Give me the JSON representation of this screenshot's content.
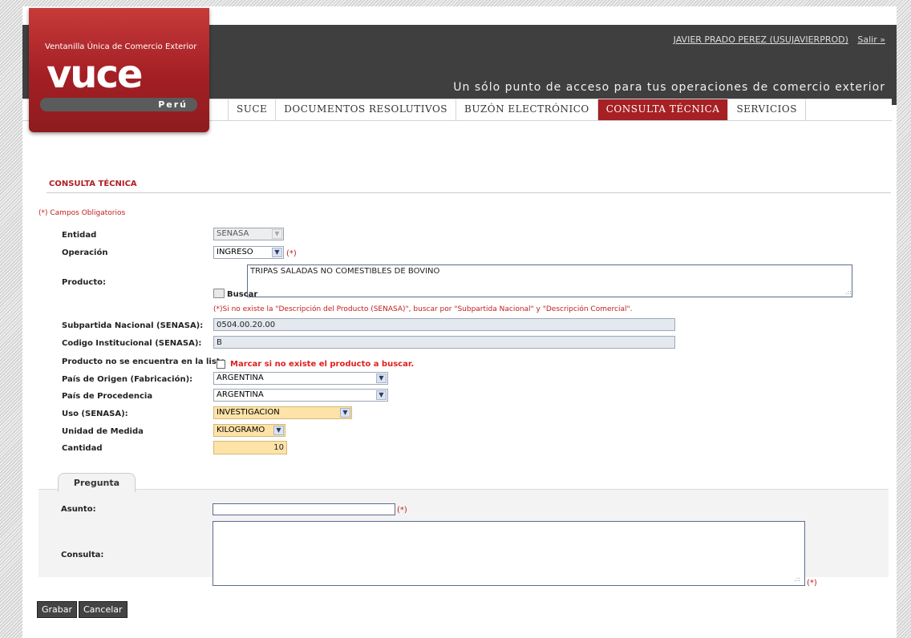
{
  "header": {
    "user_link": "JAVIER PRADO PEREZ (USUJAVIERPROD)",
    "logout_link": "Salir »",
    "tagline": "Un sólo punto de acceso para tus operaciones de comercio exterior"
  },
  "logo": {
    "subtitle": "Ventanilla Única de Comercio Exterior",
    "main": "vuce",
    "country": "Perú"
  },
  "nav": {
    "tabs": [
      {
        "label": "SUCE",
        "active": false
      },
      {
        "label": "DOCUMENTOS RESOLUTIVOS",
        "active": false
      },
      {
        "label": "BUZÓN ELECTRÓNICO",
        "active": false
      },
      {
        "label": "CONSULTA TÉCNICA",
        "active": true
      },
      {
        "label": "SERVICIOS",
        "active": false
      }
    ]
  },
  "section": {
    "title": "CONSULTA TÉCNICA",
    "required_note": "(*) Campos Obligatorios"
  },
  "form": {
    "required_mark": "(*)",
    "entidad": {
      "label": "Entidad",
      "value": "SENASA"
    },
    "operacion": {
      "label": "Operación",
      "value": "INGRESO"
    },
    "producto": {
      "label": "Producto:",
      "value": "TRIPAS SALADAS NO COMESTIBLES DE BOVINO",
      "search_label": "Buscar"
    },
    "hint": "(*)Si no existe la \"Descripción del Producto (SENASA)\", buscar por \"Subpartida Nacional\" y \"Descripción Comercial\".",
    "subpartida": {
      "label": "Subpartida Nacional (SENASA):",
      "value": "0504.00.20.00"
    },
    "codigo": {
      "label": "Codigo Institucional (SENASA):",
      "value": "B"
    },
    "no_encuentra": {
      "label": "Producto no se encuentra en la lista",
      "checkbox_label": "Marcar si no existe el producto a buscar."
    },
    "pais_origen": {
      "label": "País de Origen (Fabricación):",
      "value": "ARGENTINA"
    },
    "pais_procedencia": {
      "label": "País de Procedencia",
      "value": "ARGENTINA"
    },
    "uso": {
      "label": "Uso (SENASA):",
      "value": "INVESTIGACION"
    },
    "unidad": {
      "label": "Unidad de Medida",
      "value": "KILOGRAMO"
    },
    "cantidad": {
      "label": "Cantidad",
      "value": "10"
    }
  },
  "pregunta": {
    "tab_label": "Pregunta",
    "asunto_label": "Asunto:",
    "consulta_label": "Consulta:",
    "asunto_value": "",
    "consulta_value": ""
  },
  "buttons": {
    "save": "Grabar",
    "cancel": "Cancelar"
  },
  "colors": {
    "brand_red": "#a62024",
    "header_bg": "#3f3f3f",
    "required_red": "#c01e1e",
    "highlight_yellow": "#fde3a8"
  }
}
